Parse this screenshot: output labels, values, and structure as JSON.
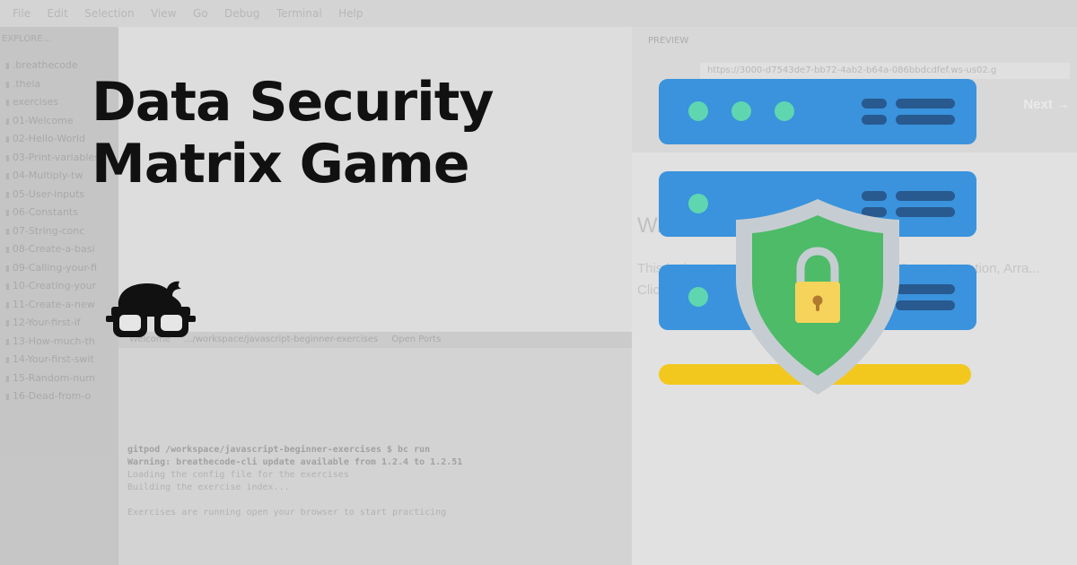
{
  "headline": {
    "line1": "Data Security",
    "line2": "Matrix Game"
  },
  "logo": {
    "icon": "nerd-glasses-logo-icon",
    "color": "#111111"
  },
  "illustration": {
    "icon": "server-security-shield-icon",
    "colors": {
      "server": "#3a93dc",
      "server_dark": "#28598f",
      "server_led": "#5fd6b0",
      "shield_outer": "#c6cdd2",
      "shield_inner": "#4dbb68",
      "lock_body": "#f6d45c",
      "lock_keyhole": "#b07a2f",
      "base_bar": "#f2c81e"
    }
  },
  "background": {
    "menu": [
      "File",
      "Edit",
      "Selection",
      "View",
      "Go",
      "Debug",
      "Terminal",
      "Help"
    ],
    "explorer_title": "EXPLORE...",
    "explorer_items": [
      ".breathecode",
      ".theia",
      "exercises",
      "01-Welcome",
      "02-Hello-World",
      "03-Print-variables",
      "04-Multiply-tw",
      "05-User-inputs",
      "06-Constants",
      "07-String-conc",
      "08-Create-a-basi",
      "09-Calling-your-fi",
      "10-Creating-your",
      "11-Create-a-new",
      "12-Your-first-if",
      "13-How-much-th",
      "14-Your-first-swit",
      "15-Random-num",
      "16-Dead-from-o"
    ],
    "terminal_tabs": [
      "Welcome",
      ".../workspace/javascript-beginner-exercises",
      "Open Ports"
    ],
    "terminal_lines": [
      "gitpod /workspace/javascript-beginner-exercises $ bc run",
      "Warning: breathecode-cli update available from 1.2.4 to 1.2.51",
      "Loading the config file for the exercises",
      "Building the exercise index...",
      "Exercises are running  open your browser to start practicing"
    ],
    "preview_title": "PREVIEW",
    "preview_url": "https://3000-d7543de7-bb72-4ab2-b64a-086bbdcdfef.ws-us02.g",
    "preview_next": "Next →",
    "preview_heading": "W... ...ises!",
    "preview_text": "This is the ... tutorial meant to giv... world of Jav... catenation, Arra... Click on Next ... side of the screen when you are ..."
  }
}
